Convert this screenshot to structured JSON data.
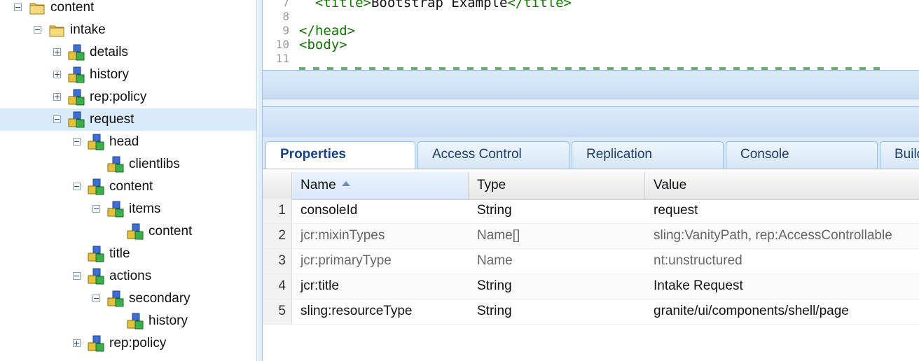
{
  "tree": {
    "items": [
      {
        "label": "content",
        "icon": "folder-icon",
        "toggle": "minus"
      },
      {
        "label": "intake",
        "icon": "folder-icon",
        "toggle": "minus"
      },
      {
        "label": "details",
        "icon": "node-icon",
        "toggle": "plus"
      },
      {
        "label": "history",
        "icon": "node-icon",
        "toggle": "plus"
      },
      {
        "label": "rep:policy",
        "icon": "node-icon",
        "toggle": "plus"
      },
      {
        "label": "request",
        "icon": "node-icon",
        "toggle": "minus",
        "selected": true
      },
      {
        "label": "head",
        "icon": "node-icon",
        "toggle": "minus"
      },
      {
        "label": "clientlibs",
        "icon": "node-icon",
        "toggle": "none"
      },
      {
        "label": "content",
        "icon": "node-icon",
        "toggle": "minus"
      },
      {
        "label": "items",
        "icon": "node-icon",
        "toggle": "minus"
      },
      {
        "label": "content",
        "icon": "node-icon",
        "toggle": "none"
      },
      {
        "label": "title",
        "icon": "node-icon",
        "toggle": "none"
      },
      {
        "label": "actions",
        "icon": "node-icon",
        "toggle": "minus"
      },
      {
        "label": "secondary",
        "icon": "node-icon",
        "toggle": "minus"
      },
      {
        "label": "history",
        "icon": "node-icon",
        "toggle": "none"
      },
      {
        "label": "rep:policy",
        "icon": "node-icon",
        "toggle": "plus"
      }
    ]
  },
  "editor": {
    "lines": [
      {
        "num": "7",
        "code": "  <title>Bootstrap Example</title>"
      },
      {
        "num": "8",
        "code": ""
      },
      {
        "num": "9",
        "code": "</head>"
      },
      {
        "num": "10",
        "code": "<body>"
      },
      {
        "num": "11",
        "code": ""
      }
    ]
  },
  "tabs": [
    "Properties",
    "Access Control",
    "Replication",
    "Console",
    "Build"
  ],
  "grid": {
    "columns": [
      "Name",
      "Type",
      "Value"
    ],
    "rows": [
      {
        "n": "1",
        "name": "consoleId",
        "type": "String",
        "value": "request",
        "protected": false
      },
      {
        "n": "2",
        "name": "jcr:mixinTypes",
        "type": "Name[]",
        "value": "sling:VanityPath, rep:AccessControllable",
        "protected": true
      },
      {
        "n": "3",
        "name": "jcr:primaryType",
        "type": "Name",
        "value": "nt:unstructured",
        "protected": true
      },
      {
        "n": "4",
        "name": "jcr:title",
        "type": "String",
        "value": "Intake Request",
        "protected": false
      },
      {
        "n": "5",
        "name": "sling:resourceType",
        "type": "String",
        "value": "granite/ui/components/shell/page",
        "protected": false
      }
    ]
  },
  "colors": {
    "accent": "#15428b",
    "tag": "#117700",
    "selection": "#d9ebfa"
  }
}
